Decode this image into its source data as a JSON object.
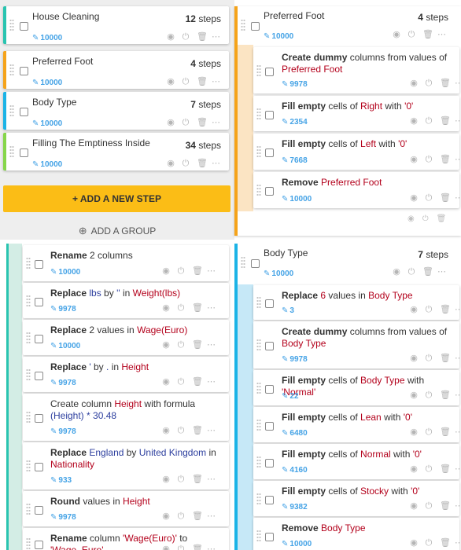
{
  "left_top": {
    "pipelines": [
      {
        "name": "House Cleaning",
        "steps_count": "12",
        "steps_label": "steps",
        "rows": "10000",
        "color": "#29c4b0"
      },
      {
        "name": "Preferred Foot",
        "steps_count": "4",
        "steps_label": "steps",
        "rows": "10000",
        "color": "#f5a31a"
      },
      {
        "name": "Body Type",
        "steps_count": "7",
        "steps_label": "steps",
        "rows": "10000",
        "color": "#1bb3e6"
      },
      {
        "name": "Filling The Emptiness Inside",
        "steps_count": "34",
        "steps_label": "steps",
        "rows": "10000",
        "color": "#86d64a"
      }
    ],
    "add_step_label": "+ ADD A NEW STEP",
    "add_group_label": "ADD A GROUP"
  },
  "right_top": {
    "pipeline_name": "Preferred Foot",
    "steps_count": "4",
    "steps_label": "steps",
    "rows": "10000",
    "accent": "#f5a31a",
    "steps": [
      {
        "parts": [
          [
            "b",
            "Create dummy"
          ],
          [
            "t",
            " columns from values of "
          ],
          [
            "c",
            "Preferred Foot"
          ]
        ],
        "rows": "9978"
      },
      {
        "parts": [
          [
            "b",
            "Fill empty"
          ],
          [
            "t",
            " cells of "
          ],
          [
            "c",
            "Right"
          ],
          [
            "t",
            " with "
          ],
          [
            "c",
            "'0'"
          ]
        ],
        "rows": "2354"
      },
      {
        "parts": [
          [
            "b",
            "Fill empty"
          ],
          [
            "t",
            " cells of "
          ],
          [
            "c",
            "Left"
          ],
          [
            "t",
            " with "
          ],
          [
            "c",
            "'0'"
          ]
        ],
        "rows": "7668"
      },
      {
        "parts": [
          [
            "b",
            "Remove"
          ],
          [
            "t",
            " "
          ],
          [
            "c",
            "Preferred Foot"
          ]
        ],
        "rows": "10000"
      }
    ]
  },
  "left_bottom": {
    "accent": "#29c4b0",
    "steps": [
      {
        "parts": [
          [
            "b",
            "Rename"
          ],
          [
            "t",
            " 2 columns"
          ]
        ],
        "rows": "10000"
      },
      {
        "parts": [
          [
            "b",
            "Replace"
          ],
          [
            "t",
            " "
          ],
          [
            "v",
            "lbs"
          ],
          [
            "t",
            " by "
          ],
          [
            "v",
            "''"
          ],
          [
            "t",
            " in "
          ],
          [
            "c",
            "Weight(lbs)"
          ]
        ],
        "rows": "9978"
      },
      {
        "parts": [
          [
            "b",
            "Replace"
          ],
          [
            "t",
            " 2 values in "
          ],
          [
            "c",
            "Wage(Euro)"
          ]
        ],
        "rows": "10000"
      },
      {
        "parts": [
          [
            "b",
            "Replace"
          ],
          [
            "t",
            " "
          ],
          [
            "v",
            "'"
          ],
          [
            "t",
            " by "
          ],
          [
            "v",
            "."
          ],
          [
            "t",
            " in "
          ],
          [
            "c",
            "Height"
          ]
        ],
        "rows": "9978"
      },
      {
        "parts": [
          [
            "t",
            "Create column "
          ],
          [
            "c",
            "Height"
          ],
          [
            "t",
            " with formula "
          ],
          [
            "v",
            "(Height) * 30.48"
          ]
        ],
        "rows": "9978"
      },
      {
        "parts": [
          [
            "b",
            "Replace"
          ],
          [
            "t",
            " "
          ],
          [
            "v",
            "England"
          ],
          [
            "t",
            " by "
          ],
          [
            "v",
            "United Kingdom"
          ],
          [
            "t",
            " in "
          ],
          [
            "c",
            "Nationality"
          ]
        ],
        "rows": "933"
      },
      {
        "parts": [
          [
            "b",
            "Round"
          ],
          [
            "t",
            " values in "
          ],
          [
            "c",
            "Height"
          ]
        ],
        "rows": "9978"
      },
      {
        "parts": [
          [
            "b",
            "Rename"
          ],
          [
            "t",
            " column "
          ],
          [
            "c",
            "'Wage(Euro)'"
          ],
          [
            "t",
            " to "
          ],
          [
            "c",
            "'Wage_Euro'"
          ]
        ],
        "rows": ""
      }
    ]
  },
  "right_bottom": {
    "pipeline_name": "Body Type",
    "steps_count": "7",
    "steps_label": "steps",
    "rows": "10000",
    "accent": "#1bb3e6",
    "steps": [
      {
        "parts": [
          [
            "b",
            "Replace"
          ],
          [
            "t",
            " "
          ],
          [
            "c",
            "6"
          ],
          [
            "t",
            " values in "
          ],
          [
            "c",
            "Body Type"
          ]
        ],
        "rows": "3"
      },
      {
        "parts": [
          [
            "b",
            "Create dummy"
          ],
          [
            "t",
            " columns from values of "
          ],
          [
            "c",
            "Body Type"
          ]
        ],
        "rows": "9978"
      },
      {
        "parts": [
          [
            "b",
            "Fill empty"
          ],
          [
            "t",
            " cells of "
          ],
          [
            "c",
            "Body Type"
          ],
          [
            "t",
            " with "
          ],
          [
            "c",
            "'Normal'"
          ]
        ],
        "rows": "22"
      },
      {
        "parts": [
          [
            "b",
            "Fill empty"
          ],
          [
            "t",
            " cells of "
          ],
          [
            "c",
            "Lean"
          ],
          [
            "t",
            " with "
          ],
          [
            "c",
            "'0'"
          ]
        ],
        "rows": "6480"
      },
      {
        "parts": [
          [
            "b",
            "Fill empty"
          ],
          [
            "t",
            " cells of "
          ],
          [
            "c",
            "Normal"
          ],
          [
            "t",
            " with "
          ],
          [
            "c",
            "'0'"
          ]
        ],
        "rows": "4160"
      },
      {
        "parts": [
          [
            "b",
            "Fill empty"
          ],
          [
            "t",
            " cells of "
          ],
          [
            "c",
            "Stocky"
          ],
          [
            "t",
            " with "
          ],
          [
            "c",
            "'0'"
          ]
        ],
        "rows": "9382"
      },
      {
        "parts": [
          [
            "b",
            "Remove"
          ],
          [
            "t",
            " "
          ],
          [
            "c",
            "Body Type"
          ]
        ],
        "rows": "10000"
      }
    ]
  },
  "icons": {
    "pencil": "✎",
    "eye": "◉",
    "power": "⏻",
    "trash": "🗑",
    "more": "⋯",
    "plus_circle": "⊕"
  }
}
